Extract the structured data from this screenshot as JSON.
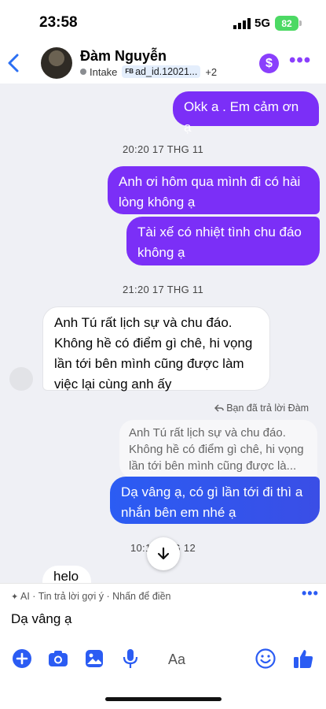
{
  "status": {
    "time": "23:58",
    "network": "5G",
    "battery": "82"
  },
  "header": {
    "name": "Đàm Nguyễn",
    "label": "Intake",
    "ad_prefix": "FB",
    "ad_tag": "ad_id.12021...",
    "extra_count": "+2",
    "dollar": "$"
  },
  "messages": {
    "m1": "Okk a . Em cảm ơn ạ",
    "ts1": "20:20 17 THG 11",
    "m2": "Anh ơi hôm qua mình đi có hài lòng không ạ",
    "m3": "Tài xế có nhiệt tình chu đáo không ạ",
    "ts2": "21:20 17 THG 11",
    "m4": "Anh Tú rất lịch sự và chu đáo. Không hề có điểm gì chê, hi vọng lần tới bên mình cũng được làm việc lại cùng anh ấy",
    "reply_note": "Bạn đã trả lời Đàm",
    "quote": "Anh Tú rất lịch sự và chu đáo. Không hề có điểm gì chê, hi vọng lần tới bên mình cũng được là...",
    "m5": "Dạ vâng ạ, có gì lần tới đi thì a nhắn bên em nhé ạ",
    "ts3": "10:17 ... G 12",
    "m6_partial": "helo"
  },
  "suggestion": {
    "text": "AI · Tin trả lời gợi ý · Nhấn để điền",
    "draft": "Dạ vâng ạ"
  },
  "composer": {
    "aa": "Aa"
  },
  "colors": {
    "accent": "#8a3ffc",
    "outgoing": "#7b2ff7",
    "outgoing_blue": "#2b5cf3",
    "link": "#2b5cf3"
  }
}
